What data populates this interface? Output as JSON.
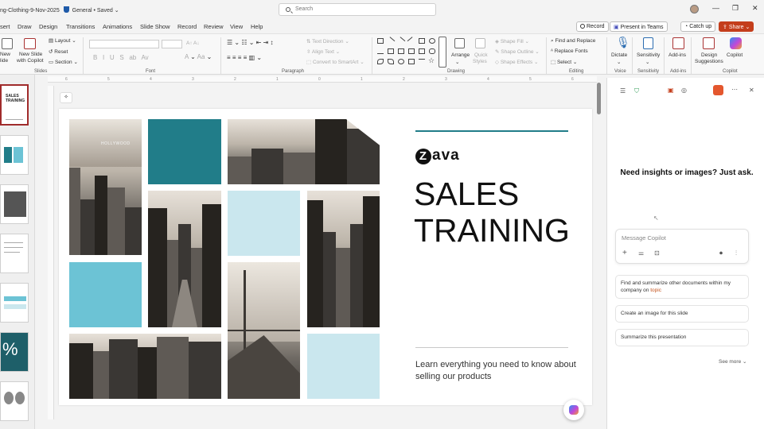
{
  "titlebar": {
    "doc_name": "ng-Clothing-9-Nov-2025",
    "sensitivity": "General",
    "save_state": "Saved",
    "search_placeholder": "Search"
  },
  "tabs": [
    "sert",
    "Draw",
    "Design",
    "Transitions",
    "Animations",
    "Slide Show",
    "Record",
    "Review",
    "View",
    "Help"
  ],
  "actions": {
    "record": "Record",
    "present": "Present in Teams",
    "catchup": "Catch up",
    "share": "Share"
  },
  "ribbon": {
    "slides": {
      "new_slide": "New",
      "new_slide_2": "lide",
      "new_copilot": "New Slide",
      "new_copilot_2": "with Copilot",
      "layout": "Layout",
      "reset": "Reset",
      "section": "Section",
      "group": "Slides"
    },
    "font": {
      "group": "Font"
    },
    "paragraph": {
      "text_direction": "Text Direction",
      "align_text": "Align Text",
      "convert": "Convert to SmartArt",
      "group": "Paragraph"
    },
    "drawing": {
      "arrange": "Arrange",
      "quick_styles": "Quick",
      "quick_styles_2": "Styles",
      "shape_fill": "Shape Fill",
      "shape_outline": "Shape Outline",
      "shape_effects": "Shape Effects",
      "group": "Drawing"
    },
    "editing": {
      "find": "Find and Replace",
      "replace_fonts": "Replace Fonts",
      "select": "Select",
      "group": "Editing"
    },
    "voice": {
      "dictate": "Dictate",
      "group": "Voice"
    },
    "sensitivity": {
      "label": "Sensitivity",
      "group": "Sensitivity"
    },
    "addins": {
      "label": "Add-ins",
      "group": "Add-ins"
    },
    "designer": {
      "label": "Design",
      "label_2": "Suggestions"
    },
    "copilot": {
      "label": "Copilot",
      "group": "Copilot"
    }
  },
  "ruler": [
    "6",
    "5",
    "4",
    "3",
    "2",
    "1",
    "0",
    "1",
    "2",
    "3",
    "4",
    "5",
    "6"
  ],
  "slide": {
    "logo": "ava",
    "logo_letter": "Z",
    "title_line1": "SALES",
    "title_line2": "TRAINING",
    "subtitle": "Learn everything you need to know about selling our products",
    "sign_text": "HOLLYWOOD"
  },
  "thumbnails": {
    "slide1_title": "SALES TRAINING",
    "slide7_text": "%"
  },
  "copilot": {
    "prompt": "Need insights or images? Just ask.",
    "placeholder": "Message Copilot",
    "suggestion1": "Find and summarize other documents within my company on",
    "suggestion1_highlight": "topic",
    "suggestion2": "Create an image for this slide",
    "suggestion3": "Summarize this presentation",
    "see_more": "See more"
  },
  "colors": {
    "teal": "#217d89",
    "sky": "#6cc3d5",
    "light": "#cae7ee",
    "share": "#c43e1c"
  }
}
